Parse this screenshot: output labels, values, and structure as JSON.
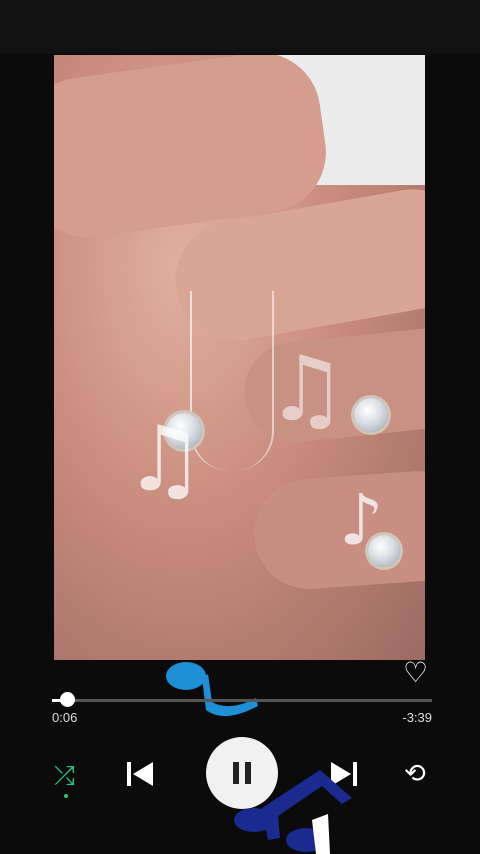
{
  "player": {
    "elapsed": "0:06",
    "remaining": "-3:39",
    "progress_fraction": 0.04
  },
  "icons": {
    "like": "heart-icon",
    "shuffle": "shuffle-icon",
    "previous": "skip-previous-icon",
    "play_pause": "pause-icon",
    "next": "skip-next-icon",
    "repeat": "repeat-icon"
  },
  "colors": {
    "background": "#0b0b0b",
    "shuffle_active": "#2ec27e",
    "note_blue": "#1e90d6",
    "note_navy": "#1a2a8f"
  }
}
